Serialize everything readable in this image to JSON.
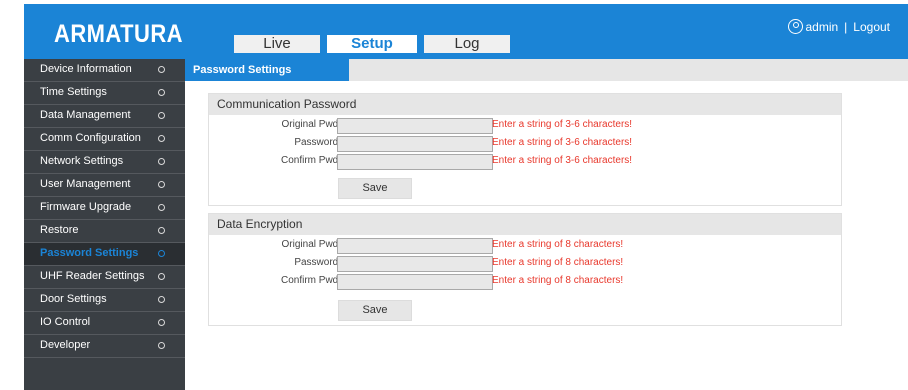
{
  "header": {
    "logo": "ARMATURA",
    "tabs": [
      {
        "label": "Live"
      },
      {
        "label": "Setup"
      },
      {
        "label": "Log"
      }
    ],
    "user": "admin",
    "separator": "|",
    "logout": "Logout",
    "active_tab": "Setup"
  },
  "sidebar": {
    "items": [
      {
        "label": "Device Information"
      },
      {
        "label": "Time Settings"
      },
      {
        "label": "Data Management"
      },
      {
        "label": "Comm Configuration"
      },
      {
        "label": "Network Settings"
      },
      {
        "label": "User Management"
      },
      {
        "label": "Firmware Upgrade"
      },
      {
        "label": "Restore"
      },
      {
        "label": "Password Settings"
      },
      {
        "label": "UHF Reader Settings"
      },
      {
        "label": "Door Settings"
      },
      {
        "label": "IO Control"
      },
      {
        "label": "Developer"
      }
    ],
    "active": "Password Settings"
  },
  "panel": {
    "tab_title": "Password Settings"
  },
  "communication": {
    "title": "Communication Password",
    "fields": [
      {
        "label": "Original Pwd:",
        "value": "",
        "hint": "Enter a string of 3-6 characters!"
      },
      {
        "label": "Password:",
        "value": "",
        "hint": "Enter a string of 3-6 characters!"
      },
      {
        "label": "Confirm Pwd:",
        "value": "",
        "hint": "Enter a string of 3-6 characters!"
      }
    ],
    "save_label": "Save"
  },
  "encryption": {
    "title": "Data Encryption",
    "fields": [
      {
        "label": "Original Pwd:",
        "value": "",
        "hint": "Enter a string of 8 characters!"
      },
      {
        "label": "Password:",
        "value": "",
        "hint": "Enter a string of 8 characters!"
      },
      {
        "label": "Confirm Pwd:",
        "value": "",
        "hint": "Enter a string of 8 characters!"
      }
    ],
    "save_label": "Save"
  },
  "colors": {
    "brand": "#1b84d6",
    "sidebar": "#3a3f44",
    "hint": "#e8382c"
  }
}
